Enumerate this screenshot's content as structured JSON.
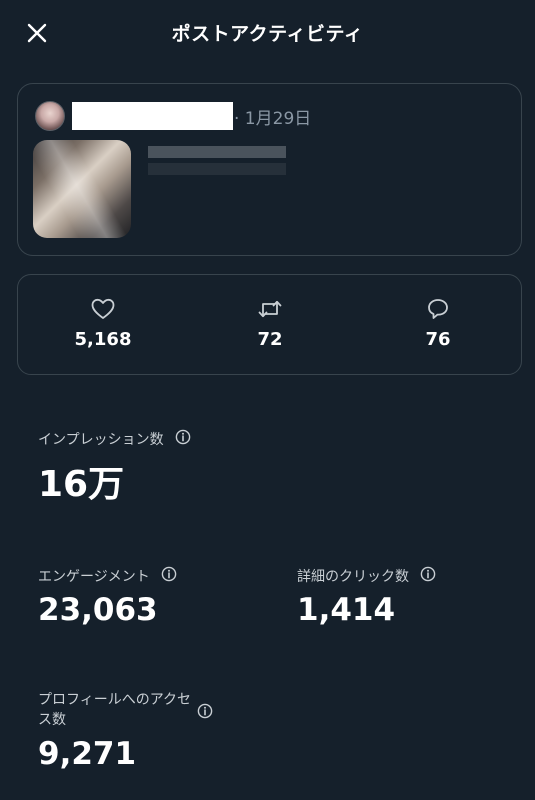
{
  "header": {
    "title": "ポストアクティビティ",
    "close_icon": "close-icon"
  },
  "post": {
    "date": "· 1月29日"
  },
  "engagement_bar": {
    "likes": {
      "icon": "heart-icon",
      "count": "5,168"
    },
    "reposts": {
      "icon": "repost-icon",
      "count": "72"
    },
    "replies": {
      "icon": "reply-icon",
      "count": "76"
    }
  },
  "metrics": {
    "impressions": {
      "label": "インプレッション数",
      "value": "16万"
    },
    "engagements": {
      "label": "エンゲージメント",
      "value": "23,063"
    },
    "detail_clicks": {
      "label": "詳細のクリック数",
      "value": "1,414"
    },
    "profile_visits": {
      "label_line1": "プロフィールへのアクセ",
      "label_line2": "ス数",
      "value": "9,271"
    }
  },
  "colors": {
    "background": "#15202b",
    "border": "#38444d",
    "text_primary": "#ffffff",
    "text_secondary": "#8b98a5"
  }
}
